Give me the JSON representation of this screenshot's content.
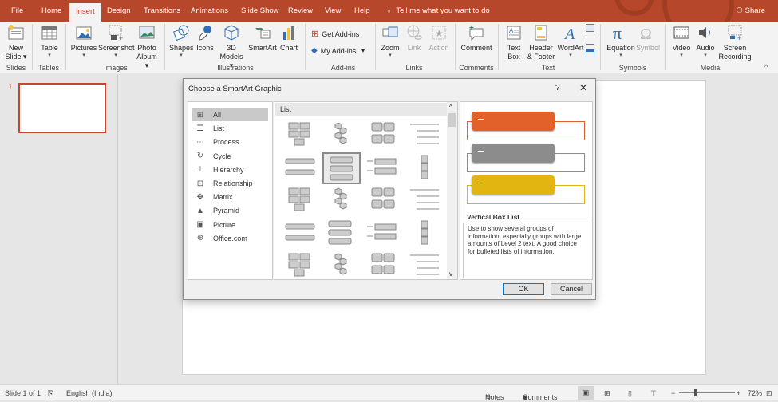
{
  "tabs": [
    "File",
    "Home",
    "Insert",
    "Design",
    "Transitions",
    "Animations",
    "Slide Show",
    "Review",
    "View",
    "Help"
  ],
  "active_tab": "Insert",
  "tell_me": "Tell me what you want to do",
  "share": "Share",
  "ribbon": {
    "new_slide": [
      "New",
      "Slide"
    ],
    "table": "Table",
    "pictures": "Pictures",
    "screenshot": "Screenshot",
    "photo_album": [
      "Photo",
      "Album"
    ],
    "shapes": "Shapes",
    "icons": "Icons",
    "models": [
      "3D",
      "Models"
    ],
    "smartart": "SmartArt",
    "chart": "Chart",
    "get_addins": "Get Add-ins",
    "my_addins": "My Add-ins",
    "zoom": "Zoom",
    "link": "Link",
    "action": "Action",
    "comment": "Comment",
    "text_box": [
      "Text",
      "Box"
    ],
    "header_footer": [
      "Header",
      "& Footer"
    ],
    "wordart": "WordArt",
    "equation": "Equation",
    "symbol": "Symbol",
    "video": "Video",
    "audio": "Audio",
    "screen_recording": [
      "Screen",
      "Recording"
    ],
    "groups": {
      "slides": "Slides",
      "tables": "Tables",
      "images": "Images",
      "illustrations": "Illustrations",
      "addins": "Add-ins",
      "links": "Links",
      "comments": "Comments",
      "text": "Text",
      "symbols": "Symbols",
      "media": "Media"
    }
  },
  "slide_panel": {
    "number": "1"
  },
  "dialog": {
    "title": "Choose a SmartArt Graphic",
    "help": "?",
    "close": "✕",
    "categories": [
      {
        "label": "All",
        "icon": "all-icon",
        "glyph": "⊞",
        "selected": true
      },
      {
        "label": "List",
        "icon": "list-icon",
        "glyph": "☰"
      },
      {
        "label": "Process",
        "icon": "process-icon",
        "glyph": "⋯"
      },
      {
        "label": "Cycle",
        "icon": "cycle-icon",
        "glyph": "↻"
      },
      {
        "label": "Hierarchy",
        "icon": "hierarchy-icon",
        "glyph": "⊥"
      },
      {
        "label": "Relationship",
        "icon": "relationship-icon",
        "glyph": "⊡"
      },
      {
        "label": "Matrix",
        "icon": "matrix-icon",
        "glyph": "✥"
      },
      {
        "label": "Pyramid",
        "icon": "pyramid-icon",
        "glyph": "▲"
      },
      {
        "label": "Picture",
        "icon": "picture-icon",
        "glyph": "▣"
      },
      {
        "label": "Office.com",
        "icon": "globe-icon",
        "glyph": "⊕"
      }
    ],
    "gallery_header": "List",
    "selected_layout": "Vertical Box List",
    "description": "Use to show several groups of information, especially groups with large amounts of Level 2 text. A good choice for bulleted lists of information.",
    "preview_colors": [
      "#e2612a",
      "#8c8c8c",
      "#e3b511"
    ],
    "ok": "OK",
    "cancel": "Cancel"
  },
  "status": {
    "slide": "Slide 1 of 1",
    "language": "English (India)",
    "notes": "Notes",
    "comments": "Comments",
    "zoom_level": "72%"
  }
}
